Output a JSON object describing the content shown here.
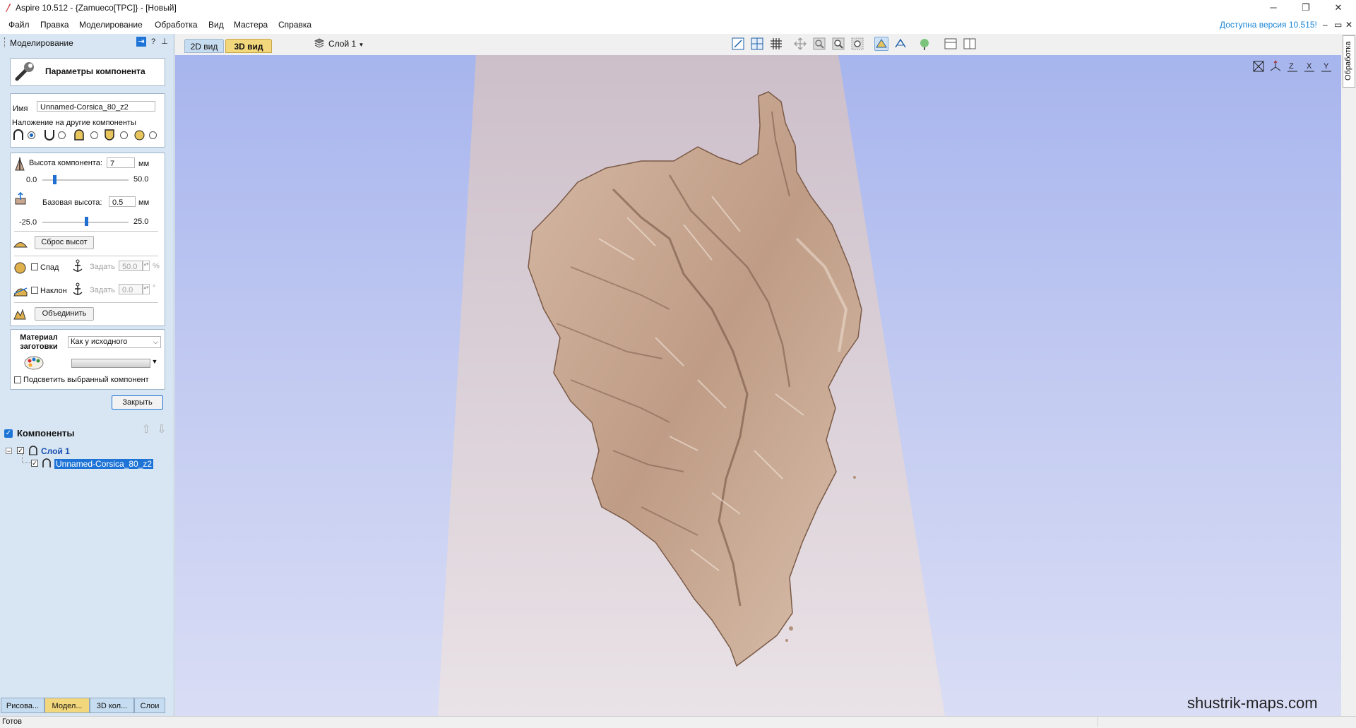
{
  "window": {
    "title": "Aspire 10.512 - {Zamueco[TPC]} - [Новый]",
    "controls": {
      "minimize": "─",
      "maximize": "❐",
      "close": "✕"
    }
  },
  "menu": {
    "items": [
      "Файл",
      "Правка",
      "Моделирование",
      "Обработка",
      "Вид",
      "Мастера",
      "Справка"
    ],
    "update_notice": "Доступна версия 10.515!",
    "mdi_controls": [
      "–",
      "▭",
      "✕"
    ]
  },
  "sidebar": {
    "title": "Моделирование",
    "component_panel": {
      "title": "Параметры компонента",
      "name_label": "Имя",
      "name_value": "Unnamed-Corsica_80_z2",
      "overlap_label": "Наложение на другие компоненты",
      "height_label": "Высота компонента:",
      "height_value": "7",
      "height_unit": "мм",
      "height_min": "0.0",
      "height_max": "50.0",
      "height_slider_fraction": 0.14,
      "base_label": "Базовая высота:",
      "base_value": "0.5",
      "base_unit": "мм",
      "base_min": "-25.0",
      "base_max": "25.0",
      "base_slider_fraction": 0.51,
      "reset_button": "Сброс высот",
      "fade_label": "Спад",
      "fade_set": "Задать",
      "fade_value": "50.0",
      "fade_unit": "%",
      "tilt_label": "Наклон",
      "tilt_set": "Задать",
      "tilt_value": "0.0",
      "tilt_unit": "°",
      "merge_button": "Объединить",
      "material_label_1": "Материал",
      "material_label_2": "заготовки",
      "material_select": "Как у исходного",
      "highlight_label": "Подсветить выбранный компонент",
      "close_button": "Закрыть"
    },
    "components": {
      "title": "Компоненты",
      "layer": "Слой 1",
      "component": "Unnamed-Corsica_80_z2"
    },
    "bottom_tabs": [
      "Рисова...",
      "Модел...",
      "3D кол...",
      "Слои"
    ]
  },
  "view": {
    "tabs": [
      "2D вид",
      "3D вид"
    ],
    "layer_selector": "Слой 1",
    "side_tab": "Обработка",
    "watermark": "shustrik-maps.com"
  },
  "status": {
    "text": "Готов"
  },
  "colors": {
    "accent": "#1e74d6",
    "tab_active": "#f3d77c",
    "tab_inactive": "#c6dcf0",
    "viewport_top": "#a7b5ee",
    "viewport_bottom": "#d9ddf5",
    "relief": "#c9a78f",
    "relief_dark": "#8a6a55"
  }
}
